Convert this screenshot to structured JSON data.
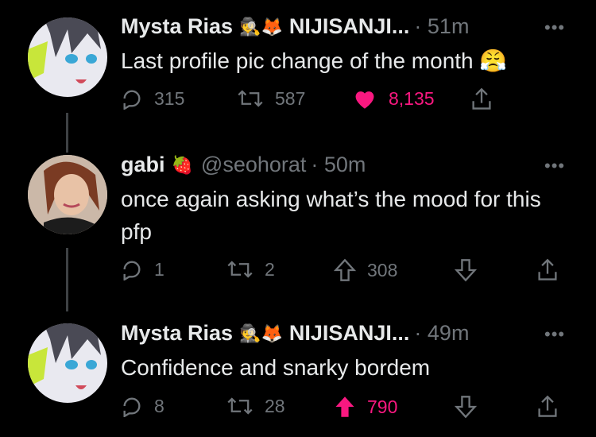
{
  "tweets": [
    {
      "name": "Mysta Rias",
      "emojis": "🕵🦊",
      "handle": "NIJISANJI...",
      "time": "· 51m",
      "text": "Last profile pic change of the month 😤",
      "actions": {
        "replies": "315",
        "retweets": "587",
        "likes": "8,135"
      }
    },
    {
      "name": "gabi",
      "emojis": "🍓",
      "handle": "@seohorat",
      "time": "· 50m",
      "text": "once again asking what’s the mood for this pfp",
      "actions": {
        "replies": "1",
        "retweets": "2",
        "votes": "308"
      }
    },
    {
      "name": "Mysta Rias",
      "emojis": "🕵🦊",
      "handle": "NIJISANJI...",
      "time": "· 49m",
      "text": "Confidence and snarky bordem",
      "actions": {
        "replies": "8",
        "retweets": "28",
        "votes": "790"
      }
    }
  ],
  "colors": {
    "accent_pink": "#f91880",
    "muted": "#71767b"
  }
}
